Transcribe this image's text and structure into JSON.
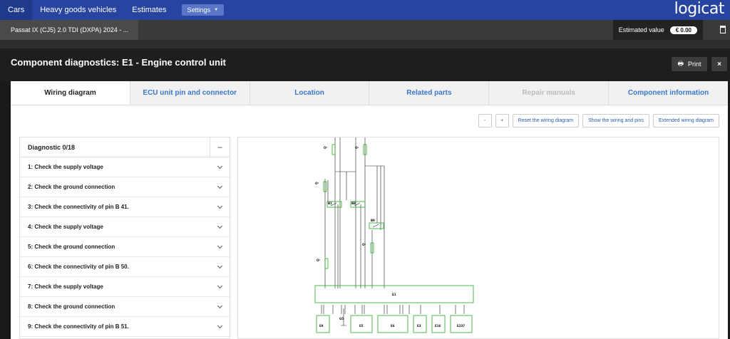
{
  "nav": {
    "items": [
      "Cars",
      "Heavy goods vehicles",
      "Estimates"
    ],
    "settings_label": "Settings",
    "logo": "logicat"
  },
  "vehicle": {
    "name": "Passat IX (CJ5) 2.0 TDI (DXPA) 2024 - ...",
    "estimated_label": "Estimated value",
    "estimated_currency": "€",
    "estimated_value": "0.00"
  },
  "page": {
    "title": "Component diagnostics: E1 - Engine control unit",
    "print_label": "Print",
    "close_label": "×"
  },
  "tabs": [
    {
      "label": "Wiring diagram",
      "state": "active"
    },
    {
      "label": "ECU unit pin and connector",
      "state": "normal"
    },
    {
      "label": "Location",
      "state": "normal"
    },
    {
      "label": "Related parts",
      "state": "normal"
    },
    {
      "label": "Repair manuals",
      "state": "disabled"
    },
    {
      "label": "Component information",
      "state": "normal"
    }
  ],
  "tools": {
    "zoom_out": "-",
    "zoom_in": "+",
    "reset": "Reset the wiring diagram",
    "show_pins": "Show the wiring and pins",
    "extended": "Extended wiring diagram"
  },
  "diagnostic": {
    "title": "Diagnostic 0/18",
    "collapse_label": "–",
    "items": [
      "1: Check the supply voltage",
      "2: Check the ground connection",
      "3: Check the connectivity of pin B 41.",
      "4: Check the supply voltage",
      "5: Check the ground connection",
      "6: Check the connectivity of pin B 50.",
      "7: Check the supply voltage",
      "8: Check the ground connection",
      "9: Check the connectivity of pin B 51."
    ]
  },
  "wiring": {
    "ecu_label": "E1",
    "relays": [
      "B1",
      "B8",
      "B9"
    ],
    "connectors": [
      "E9",
      "E5",
      "E6",
      "E3",
      "E16",
      "E237"
    ],
    "ground": "G5",
    "fuse_label": "O²",
    "colors": {
      "wire": "#222222",
      "component": "#22aa22",
      "pin_text": "#3333aa",
      "wire_code": "#cc3333"
    }
  }
}
